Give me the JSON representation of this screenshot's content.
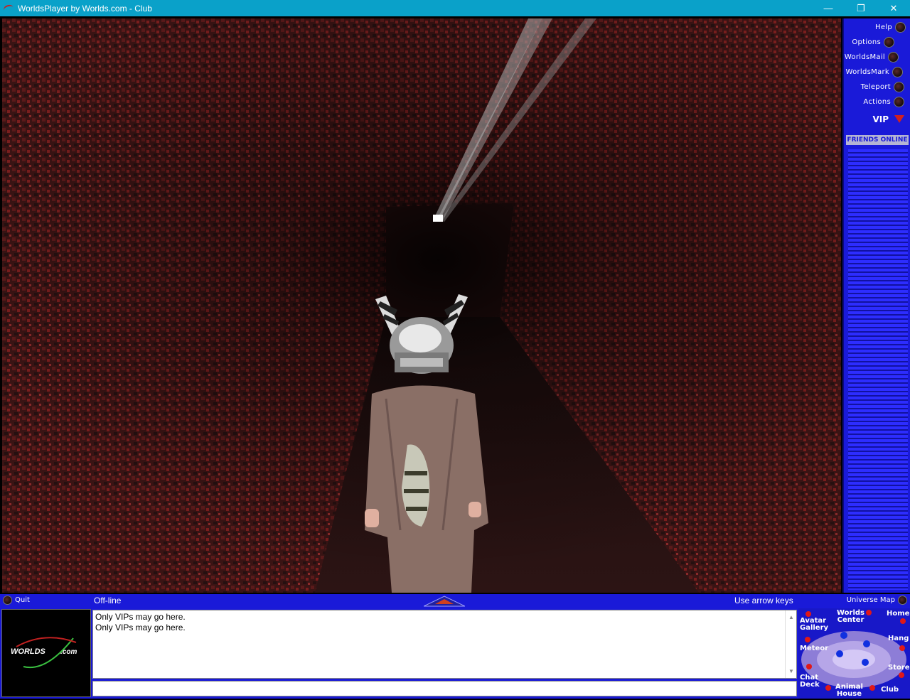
{
  "window": {
    "title": "WorldsPlayer by Worlds.com - Club",
    "minimize": "—",
    "maximize": "❐",
    "close": "✕"
  },
  "side_menu": {
    "items": [
      {
        "label": "Help"
      },
      {
        "label": "Options"
      },
      {
        "label": "WorldsMail"
      },
      {
        "label": "WorldsMark"
      },
      {
        "label": "Teleport"
      },
      {
        "label": "Actions"
      }
    ],
    "vip_label": "VIP",
    "friends_header": "FRIENDS ONLINE"
  },
  "status_bar": {
    "quit_label": "Quit",
    "status_text": "Off-line",
    "hint_text": "Use arrow keys",
    "universe_map_label": "Universe Map"
  },
  "chat": {
    "messages": [
      "Only VIPs may go here.",
      "Only VIPs may go here."
    ],
    "input_value": ""
  },
  "logo": {
    "text": "WORLDS",
    "suffix": ".com"
  },
  "universe_map": {
    "locations": {
      "avatar_gallery": "Avatar\nGallery",
      "worlds_center": "Worlds\nCenter",
      "home": "Home",
      "hang": "Hang",
      "meteor": "Meteor",
      "store": "Store",
      "chat_deck": "Chat\nDeck",
      "animal_house": "Animal\nHouse",
      "club": "Club"
    }
  },
  "colors": {
    "titlebar": "#0aa1c9",
    "panel_blue": "#1a1ad8",
    "pin_red": "#e01818",
    "pin_blue": "#1030e0"
  }
}
